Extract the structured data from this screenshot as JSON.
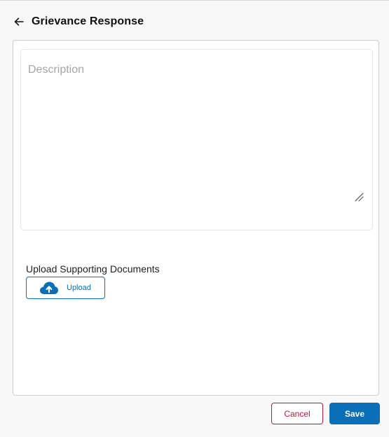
{
  "header": {
    "title": "Grievance Response",
    "back_icon": "arrow-left-icon"
  },
  "form": {
    "description": {
      "value": "",
      "placeholder": "Description"
    },
    "upload": {
      "label": "Upload Supporting Documents",
      "button_label": "Upload",
      "icon": "cloud-upload-icon"
    }
  },
  "actions": {
    "cancel_label": "Cancel",
    "save_label": "Save"
  },
  "colors": {
    "primary": "#0a6fb8",
    "danger": "#c0143c",
    "background": "#f8f8f8"
  }
}
